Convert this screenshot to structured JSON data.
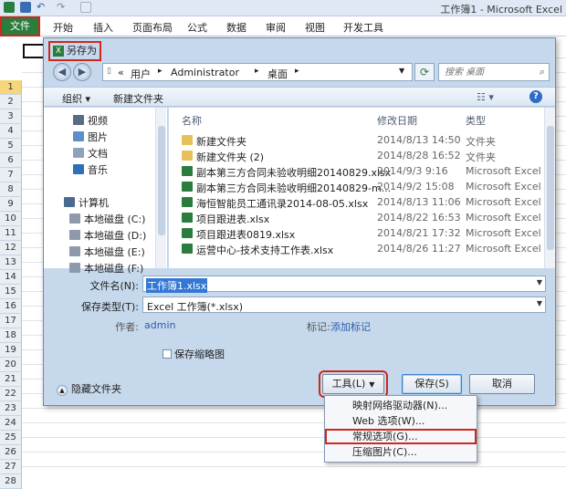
{
  "app": {
    "title": "工作簿1 - Microsoft Excel",
    "ribbon_tabs": [
      "文件",
      "开始",
      "插入",
      "页面布局",
      "公式",
      "数据",
      "审阅",
      "视图",
      "开发工具"
    ],
    "rows": [
      "1",
      "2",
      "3",
      "4",
      "5",
      "6",
      "7",
      "8",
      "9",
      "10",
      "11",
      "12",
      "13",
      "14",
      "15",
      "16",
      "17",
      "18",
      "19",
      "20",
      "21",
      "22",
      "23",
      "24",
      "25",
      "26",
      "27",
      "28"
    ]
  },
  "dialog": {
    "title": "另存为",
    "breadcrumb": [
      "«",
      "用户",
      "▸",
      "Administrator",
      "▸",
      "桌面",
      "▸"
    ],
    "search_placeholder": "搜索 桌面",
    "toolbar": {
      "organize": "组织 ▾",
      "new_folder": "新建文件夹",
      "view_icon": "☷ ▾",
      "help": "?"
    },
    "nav": [
      {
        "label": "视频",
        "icon": "video-icon",
        "color": "#5a6b85"
      },
      {
        "label": "图片",
        "icon": "picture-icon",
        "color": "#5b8fc9"
      },
      {
        "label": "文档",
        "icon": "document-icon",
        "color": "#8fa2bb"
      },
      {
        "label": "音乐",
        "icon": "music-icon",
        "color": "#2f6fb7"
      },
      {
        "label": "计算机",
        "icon": "computer-icon",
        "color": "#4a6a92"
      },
      {
        "label": "本地磁盘 (C:)",
        "icon": "drive-icon",
        "color": "#8c9aab"
      },
      {
        "label": "本地磁盘 (D:)",
        "icon": "drive-icon",
        "color": "#8c9aab"
      },
      {
        "label": "本地磁盘 (E:)",
        "icon": "drive-icon",
        "color": "#8c9aab"
      },
      {
        "label": "本地磁盘 (F:)",
        "icon": "drive-icon",
        "color": "#8c9aab"
      }
    ],
    "columns": {
      "name": "名称",
      "date": "修改日期",
      "type": "类型"
    },
    "files": [
      {
        "name": "新建文件夹",
        "date": "2014/8/13 14:50",
        "type": "文件夹",
        "kind": "folder"
      },
      {
        "name": "新建文件夹 (2)",
        "date": "2014/8/28 16:52",
        "type": "文件夹",
        "kind": "folder"
      },
      {
        "name": "副本第三方合同未验收明细20140829.xlsx",
        "date": "2014/9/3 9:16",
        "type": "Microsoft Excel",
        "kind": "excel"
      },
      {
        "name": "副本第三方合同未验收明细20140829-m...",
        "date": "2014/9/2 15:08",
        "type": "Microsoft Excel",
        "kind": "excel"
      },
      {
        "name": "海恒智能员工通讯录2014-08-05.xlsx",
        "date": "2014/8/13 11:06",
        "type": "Microsoft Excel",
        "kind": "excel"
      },
      {
        "name": "项目跟进表.xlsx",
        "date": "2014/8/22 16:53",
        "type": "Microsoft Excel",
        "kind": "excel"
      },
      {
        "name": "项目跟进表0819.xlsx",
        "date": "2014/8/21 17:32",
        "type": "Microsoft Excel",
        "kind": "excel"
      },
      {
        "name": "运营中心-技术支持工作表.xlsx",
        "date": "2014/8/26 11:27",
        "type": "Microsoft Excel",
        "kind": "excel"
      }
    ],
    "filename_label": "文件名(N):",
    "filename_value": "工作簿1.xlsx",
    "filetype_label": "保存类型(T):",
    "filetype_value": "Excel 工作簿(*.xlsx)",
    "author_label": "作者:",
    "author_value": "admin",
    "tags_label": "标记:",
    "tags_value": "添加标记",
    "thumbnail_label": "保存缩略图",
    "hide_folders": "隐藏文件夹",
    "tools_label": "工具(L)",
    "save_label": "保存(S)",
    "cancel_label": "取消"
  },
  "tools_menu": [
    "映射网络驱动器(N)...",
    "Web 选项(W)...",
    "常规选项(G)...",
    "压缩图片(C)..."
  ],
  "colors": {
    "excel_green": "#2a7d3d",
    "highlight_red": "#d0271d",
    "selection_blue": "#3378d4",
    "folder_yellow": "#e8c05a"
  }
}
